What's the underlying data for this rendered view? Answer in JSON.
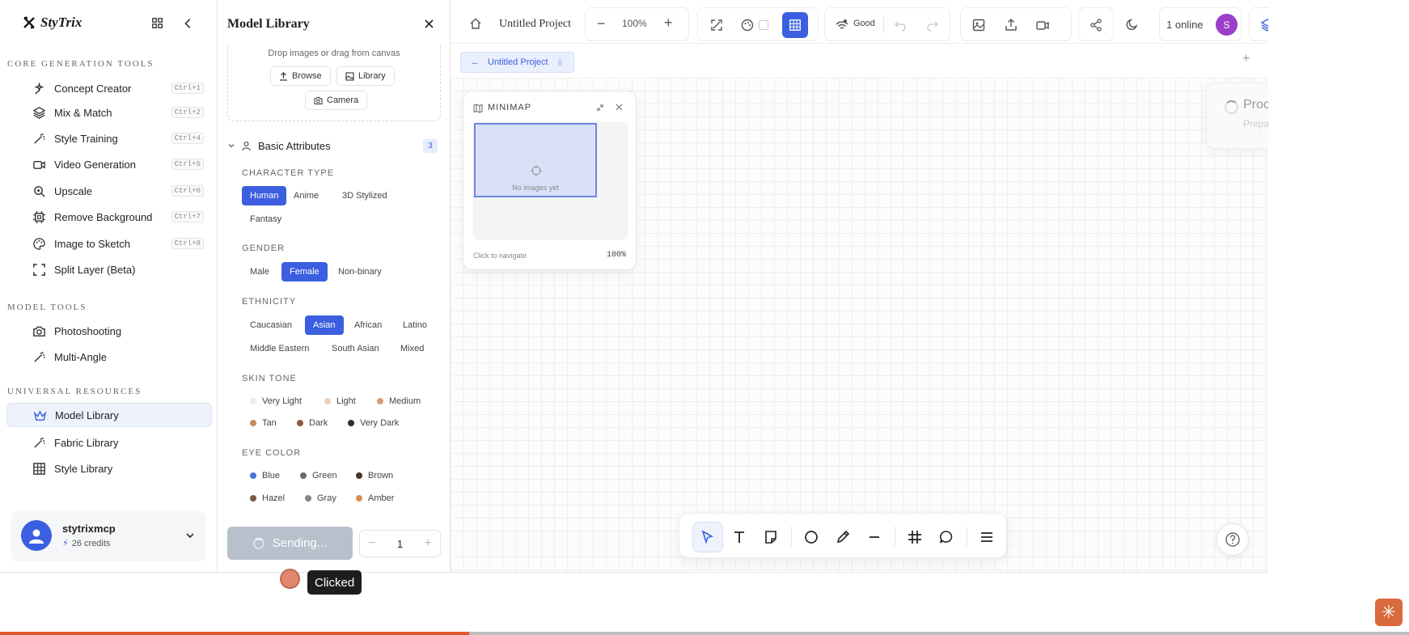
{
  "brand": {
    "name": "StyTrix"
  },
  "sidebar": {
    "sections": [
      {
        "title": "CORE GENERATION TOOLS"
      },
      {
        "title": "MODEL TOOLS"
      },
      {
        "title": "UNIVERSAL RESOURCES"
      }
    ],
    "core": [
      {
        "label": "Concept Creator",
        "shortcut": "Ctrl+1",
        "icon": "sparkles-icon"
      },
      {
        "label": "Mix & Match",
        "shortcut": "Ctrl+2",
        "icon": "layers-icon"
      },
      {
        "label": "Style Training",
        "shortcut": "Ctrl+4",
        "icon": "wand-icon"
      },
      {
        "label": "Video Generation",
        "shortcut": "Ctrl+5",
        "icon": "video-icon"
      },
      {
        "label": "Upscale",
        "shortcut": "Ctrl+6",
        "icon": "zoom-in-icon"
      },
      {
        "label": "Remove Background",
        "shortcut": "Ctrl+7",
        "icon": "chip-icon"
      },
      {
        "label": "Image to Sketch",
        "shortcut": "Ctrl+8",
        "icon": "palette-icon"
      },
      {
        "label": "Split Layer (Beta)",
        "shortcut": "",
        "icon": "scan-icon"
      }
    ],
    "model": [
      {
        "label": "Photoshooting",
        "icon": "camera-icon"
      },
      {
        "label": "Multi-Angle",
        "icon": "wand-icon"
      }
    ],
    "resources": [
      {
        "label": "Model Library",
        "icon": "crown-icon",
        "active": true
      },
      {
        "label": "Fabric Library",
        "icon": "wand-icon"
      },
      {
        "label": "Style Library",
        "icon": "grid-icon"
      }
    ],
    "user": {
      "name": "stytrixmcp",
      "credits": "26 credits"
    }
  },
  "panel": {
    "title": "Model Library",
    "drop_text": "Drop images or drag from canvas",
    "browse": "Browse",
    "library": "Library",
    "camera": "Camera",
    "group": {
      "title": "Basic Attributes",
      "count": "3"
    },
    "character_type": {
      "label": "CHARACTER TYPE",
      "options": [
        "Human",
        "Anime",
        "3D Stylized",
        "Fantasy"
      ],
      "selected": "Human"
    },
    "gender": {
      "label": "GENDER",
      "options": [
        "Male",
        "Female",
        "Non-binary"
      ],
      "selected": "Female"
    },
    "ethnicity": {
      "label": "ETHNICITY",
      "options": [
        "Caucasian",
        "Asian",
        "African",
        "Latino",
        "Middle Eastern",
        "South Asian",
        "Mixed"
      ],
      "selected": "Asian"
    },
    "skin_tone": {
      "label": "SKIN TONE",
      "options": [
        {
          "name": "Very Light",
          "color": "#f0ebe6"
        },
        {
          "name": "Light",
          "color": "#edcfb7"
        },
        {
          "name": "Medium",
          "color": "#d69c78"
        },
        {
          "name": "Tan",
          "color": "#c48a62"
        },
        {
          "name": "Dark",
          "color": "#8a5a3c"
        },
        {
          "name": "Very Dark",
          "color": "#3a2a22"
        }
      ]
    },
    "eye_color": {
      "label": "EYE COLOR",
      "options": [
        {
          "name": "Blue",
          "color": "#4a78d6"
        },
        {
          "name": "Green",
          "color": "#6a6a6a"
        },
        {
          "name": "Brown",
          "color": "#4a3322"
        },
        {
          "name": "Hazel",
          "color": "#7a5c44"
        },
        {
          "name": "Gray",
          "color": "#858585"
        },
        {
          "name": "Amber",
          "color": "#d48c55"
        }
      ]
    },
    "send_label": "Sending...",
    "quantity": "1"
  },
  "topbar": {
    "project_title": "Untitled Project",
    "zoom": "100%",
    "status": "Good",
    "online": "1 online",
    "avatar_letter": "S"
  },
  "canvas": {
    "tab_label": "Untitled Project",
    "minimap": {
      "title": "MINIMAP",
      "empty": "No images yet",
      "footer": "Click to navigate",
      "zoom": "100%"
    },
    "toast": {
      "title": "Processing",
      "subtitle": "Preparing"
    }
  },
  "overlay": {
    "click_label": "Clicked",
    "progress": 0.333
  },
  "colors": {
    "accent": "#3b5fe0",
    "progress": "#e05a2b"
  }
}
